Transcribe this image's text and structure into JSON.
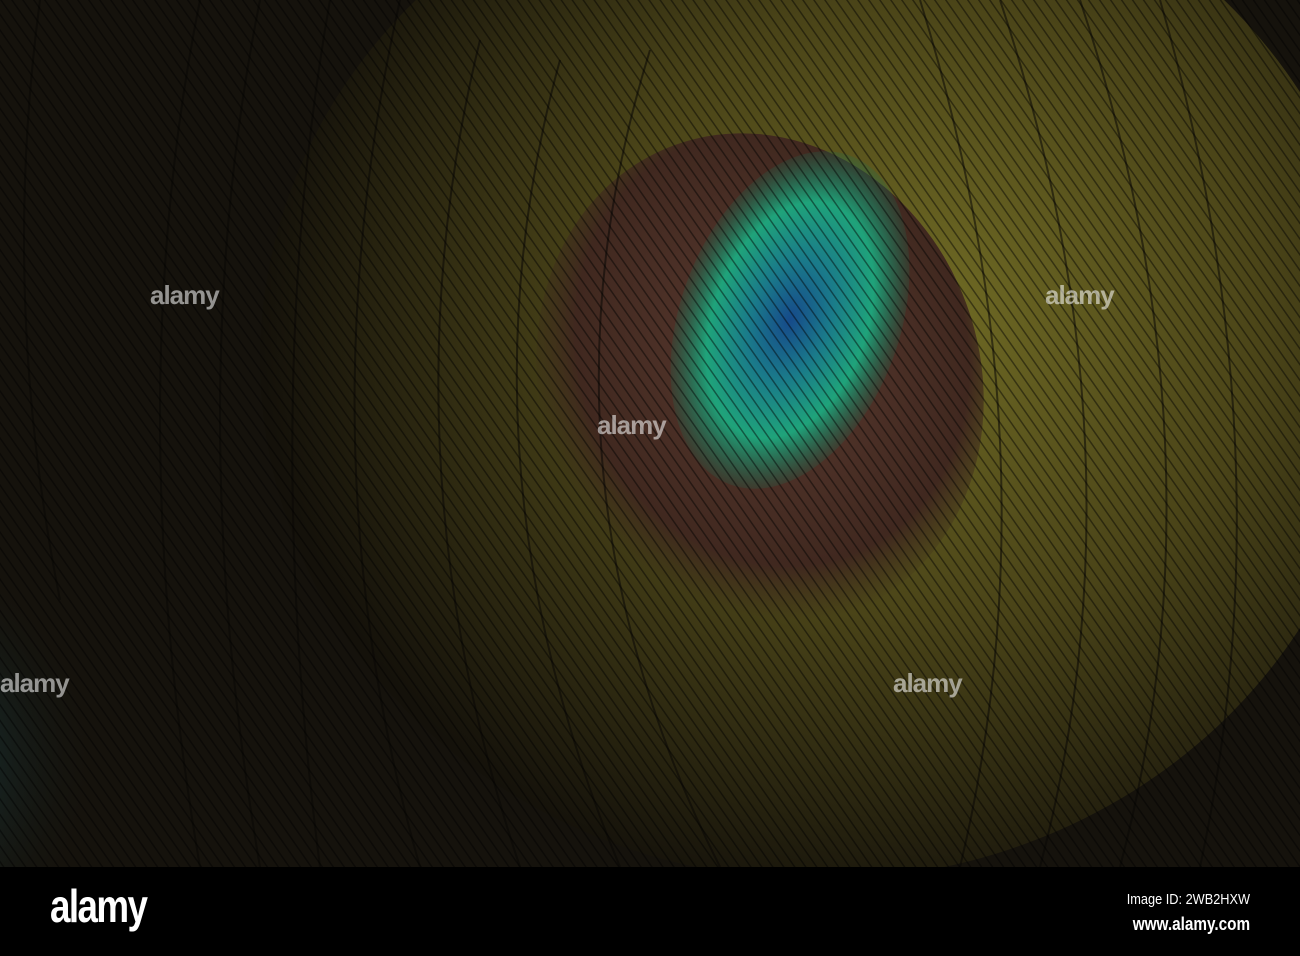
{
  "image": {
    "subject": "peacock-feather-eye"
  },
  "watermark": {
    "text": "alamy"
  },
  "footer": {
    "logo": "alamy",
    "image_id": "Image ID: 2WB2HXW",
    "site": "www.alamy.com"
  },
  "colors": {
    "background": "#15120c",
    "brown": "#4a3028",
    "green": "#1fa37a",
    "blue": "#1b4f8a",
    "gold": "#8a8a2a"
  }
}
